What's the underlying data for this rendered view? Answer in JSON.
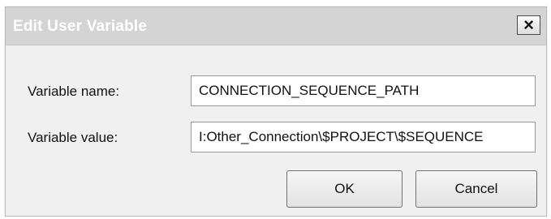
{
  "dialog": {
    "title": "Edit User Variable",
    "close_glyph": "×"
  },
  "form": {
    "name_label": "Variable name:",
    "name_value": "CONNECTION_SEQUENCE_PATH",
    "value_label": "Variable value:",
    "value_value": "I:Other_Connection\\$PROJECT\\$SEQUENCE"
  },
  "buttons": {
    "ok_label": "OK",
    "cancel_label": "Cancel"
  }
}
